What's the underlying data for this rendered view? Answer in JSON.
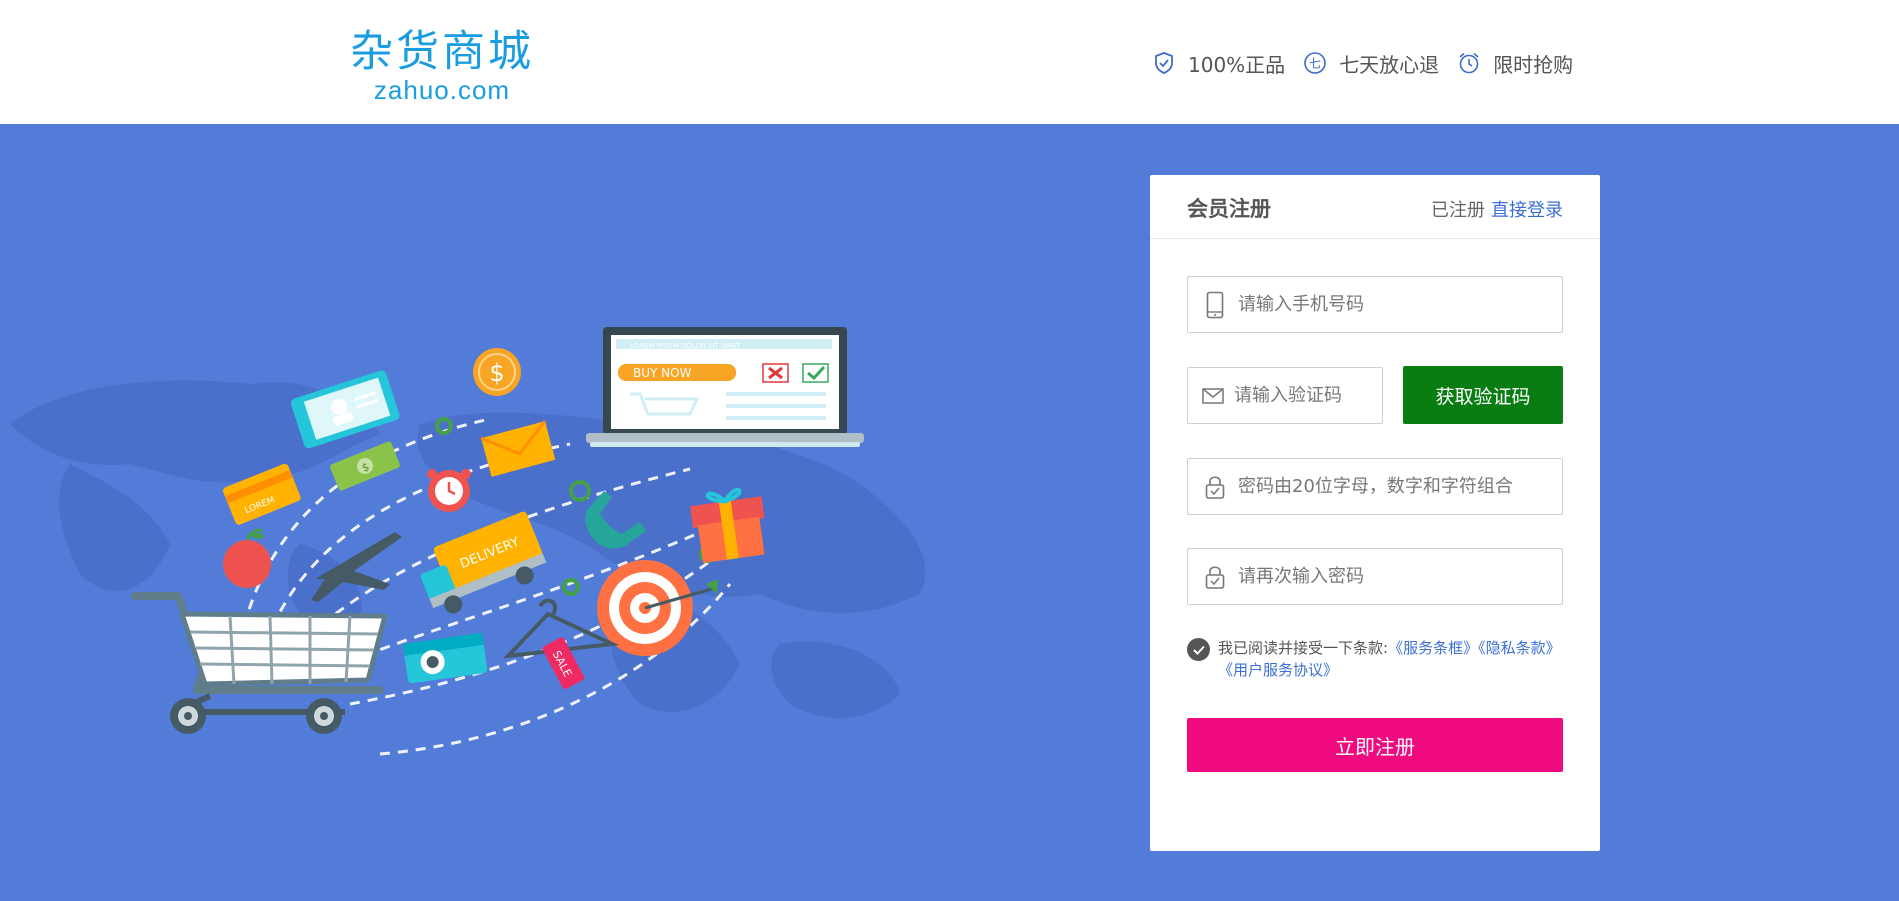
{
  "header": {
    "logo_cn": "杂货商城",
    "logo_en": "zahuo.com",
    "promises": [
      {
        "icon": "shield-check-icon",
        "label": "100%正品"
      },
      {
        "icon": "seven-day-icon",
        "label": "七天放心退"
      },
      {
        "icon": "alarm-clock-icon",
        "label": "限时抢购"
      }
    ]
  },
  "illustration": {
    "laptop_banner": "LOREM IPSUM DOLOR SIT AMET",
    "buy_now": "BUY NOW",
    "card_label": "LOREM",
    "truck_label": "DELIVERY",
    "tag_label": "SALE",
    "money_symbol": "$"
  },
  "register": {
    "title": "会员注册",
    "already_registered": "已注册",
    "login_link": "直接登录",
    "phone_placeholder": "请输入手机号码",
    "code_placeholder": "请输入验证码",
    "get_code_button": "获取验证码",
    "password_placeholder": "密码由20位字母，数字和字符组合",
    "confirm_placeholder": "请再次输入密码",
    "terms_prefix": "我已阅读并接受一下条款:",
    "terms_link_1": "《服务条框》",
    "terms_link_2": "《隐私条款》",
    "terms_link_3": "《用户服务协议》",
    "submit_button": "立即注册"
  },
  "colors": {
    "hero_bg": "#537cd9",
    "brand_blue": "#1a9de0",
    "code_button": "#0a7d12",
    "submit_button": "#ef0a80",
    "link": "#3b6fd4"
  }
}
